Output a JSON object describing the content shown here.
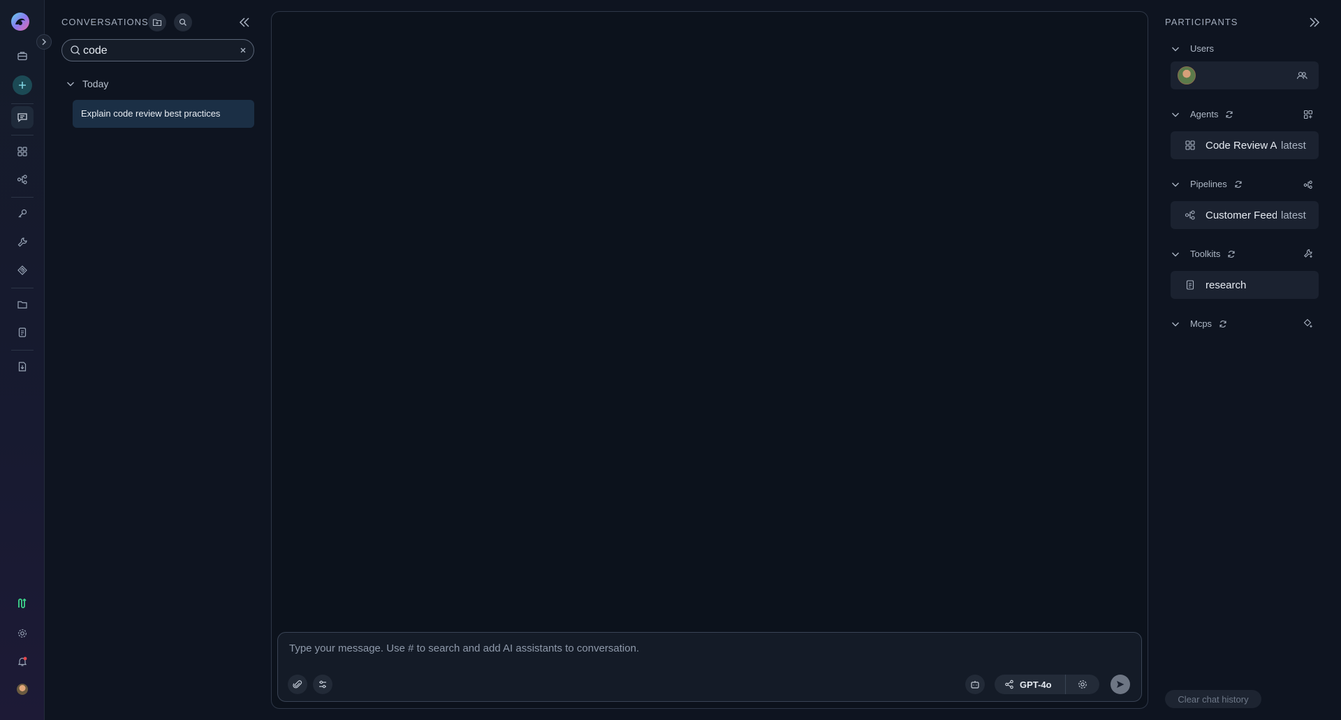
{
  "rail": {
    "items": [
      {
        "name": "briefcase"
      },
      {
        "name": "new-conversation"
      },
      {
        "name": "chat"
      },
      {
        "name": "agents"
      },
      {
        "name": "pipelines"
      },
      {
        "name": "credentials"
      },
      {
        "name": "toolkits"
      },
      {
        "name": "mcps"
      },
      {
        "name": "artifacts"
      },
      {
        "name": "prompts"
      },
      {
        "name": "import"
      }
    ]
  },
  "conversations": {
    "title": "CONVERSATIONS",
    "search": {
      "value": "code",
      "placeholder": ""
    },
    "groups": [
      {
        "label": "Today",
        "items": [
          {
            "title": "Explain code review best practices"
          }
        ]
      }
    ]
  },
  "composer": {
    "placeholder": "Type your message. Use # to search and add AI assistants to conversation.",
    "model": "GPT-4o"
  },
  "participants": {
    "title": "PARTICIPANTS",
    "sections": {
      "users": {
        "label": "Users"
      },
      "agents": {
        "label": "Agents",
        "item": {
          "name": "Code Review Assistant",
          "version": "latest"
        }
      },
      "pipelines": {
        "label": "Pipelines",
        "item": {
          "name": "Customer Feedback",
          "version": "latest"
        }
      },
      "toolkits": {
        "label": "Toolkits",
        "item": {
          "name": "research"
        }
      },
      "mcps": {
        "label": "Mcps"
      }
    },
    "clear_history": "Clear chat history"
  },
  "colors": {
    "accent": "#1b2f45",
    "background": "#0e1420",
    "panel": "#1b2230"
  }
}
